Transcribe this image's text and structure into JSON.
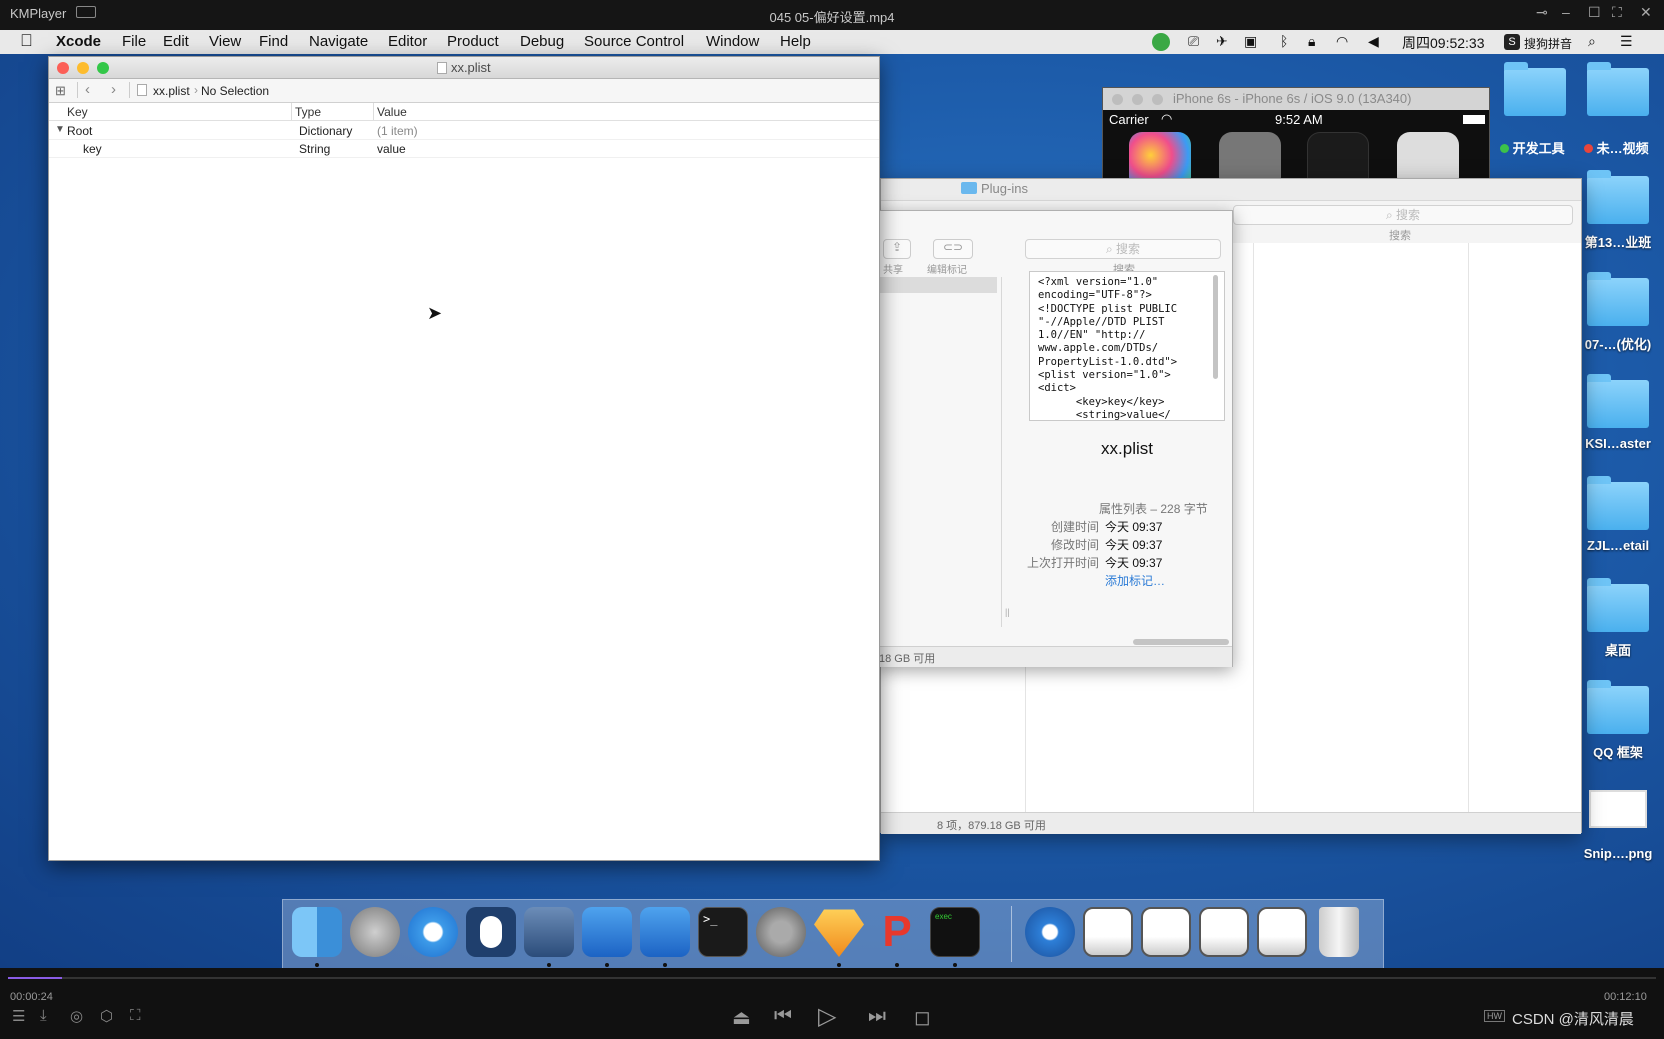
{
  "player": {
    "app_name": "KMPlayer",
    "window_title": "045 05-偏好设置.mp4",
    "time_current": "00:00:24",
    "time_total": "00:12:10",
    "progress_fraction": 0.033,
    "watermark": "CSDN @清风清晨"
  },
  "menubar": {
    "app": "Xcode",
    "items": [
      "File",
      "Edit",
      "View",
      "Find",
      "Navigate",
      "Editor",
      "Product",
      "Debug",
      "Source Control",
      "Window",
      "Help"
    ],
    "clock": "周四09:52:33",
    "input_method": "搜狗拼音"
  },
  "xcode": {
    "title": "xx.plist",
    "breadcrumb_file": "xx.plist",
    "breadcrumb_selection": "No Selection",
    "columns": [
      "Key",
      "Type",
      "Value"
    ],
    "rows": [
      {
        "key": "Root",
        "type": "Dictionary",
        "value": "(1 item)"
      },
      {
        "key": "key",
        "type": "String",
        "value": "value"
      }
    ]
  },
  "simulator": {
    "title": "iPhone 6s - iPhone 6s / iOS 9.0 (13A340)",
    "carrier": "Carrier",
    "time": "9:52 AM"
  },
  "finder": {
    "folder_title": "Plug-ins",
    "share_label": "共享",
    "tag_label": "编辑标记",
    "search_placeholder": "搜索",
    "search_label": "搜索",
    "back_search_placeholder": "搜索",
    "back_search_label": "搜索",
    "preview_text": "<?xml version=\"1.0\"\nencoding=\"UTF-8\"?>\n<!DOCTYPE plist PUBLIC\n\"-//Apple//DTD PLIST\n1.0//EN\" \"http://\nwww.apple.com/DTDs/\nPropertyList-1.0.dtd\">\n<plist version=\"1.0\">\n<dict>\n      <key>key</key>\n      <string>value</",
    "file_name": "xx.plist",
    "kind_size": "属性列表 – 228 字节",
    "created_label": "创建时间",
    "created_value": "今天 09:37",
    "modified_label": "修改时间",
    "modified_value": "今天 09:37",
    "opened_label": "上次打开时间",
    "opened_value": "今天 09:37",
    "add_tags": "添加标记…",
    "front_status": "18 GB 可用",
    "back_status": "8 项，879.18 GB 可用"
  },
  "desktop": {
    "tags": [
      {
        "label": "开发工具",
        "color": "#3cc24a"
      },
      {
        "label": "未…视频",
        "color": "#e8453c"
      }
    ],
    "icons": [
      "第13…业班",
      "07-…(优化)",
      "KSI…aster",
      "ZJL…etail",
      "桌面",
      "QQ 框架",
      "Snip….png"
    ]
  },
  "colors": {
    "accent_blue": "#2b7bd6",
    "progress": "#8a5ce6",
    "close": "#fc5f57",
    "minimize": "#fdbc2e",
    "zoom": "#33c748"
  }
}
